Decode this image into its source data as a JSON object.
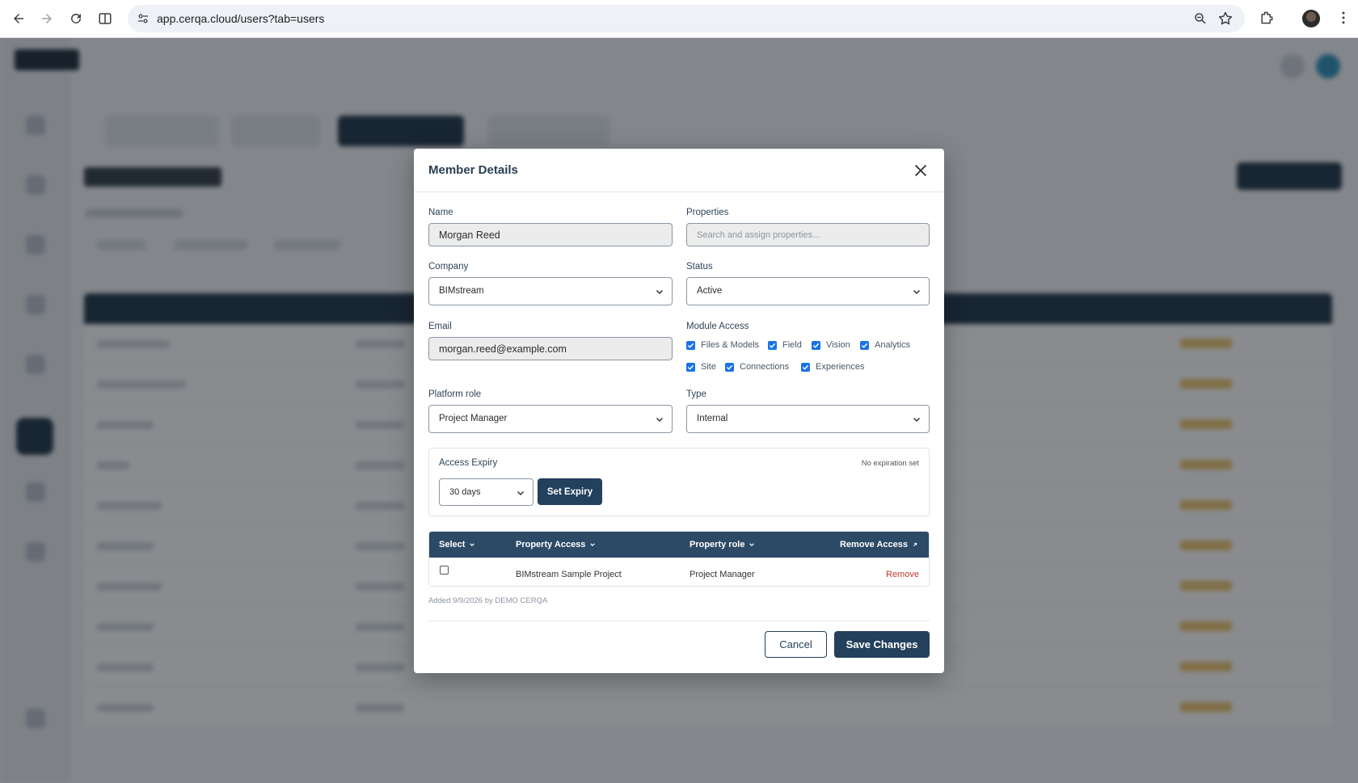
{
  "browser": {
    "url": "app.cerqa.cloud/users?tab=users"
  },
  "modal": {
    "title": "Member Details",
    "name": {
      "label": "Name",
      "value": "Morgan Reed"
    },
    "properties": {
      "label": "Properties",
      "placeholder": "Search and assign properties..."
    },
    "company": {
      "label": "Company",
      "value": "BIMstream"
    },
    "status": {
      "label": "Status",
      "value": "Active"
    },
    "email": {
      "label": "Email",
      "value": "morgan.reed@example.com"
    },
    "module_access": {
      "label": "Module Access",
      "modules": [
        {
          "label": "Files & Models",
          "checked": true
        },
        {
          "label": "Field",
          "checked": true
        },
        {
          "label": "Vision",
          "checked": true
        },
        {
          "label": "Analytics",
          "checked": true
        },
        {
          "label": "Site",
          "checked": true
        },
        {
          "label": "Connections",
          "checked": true
        },
        {
          "label": "Experiences",
          "checked": true
        }
      ]
    },
    "platform_role": {
      "label": "Platform role",
      "value": "Project Manager"
    },
    "type": {
      "label": "Type",
      "value": "Internal"
    },
    "access_expiry": {
      "label": "Access Expiry",
      "status": "No expiration set",
      "duration": "30 days",
      "set_button": "Set Expiry"
    },
    "table": {
      "headers": [
        "Select",
        "Property Access",
        "Property role",
        "Remove Access"
      ],
      "rows": [
        {
          "selected": false,
          "property": "BIMstream Sample Project",
          "role": "Project Manager",
          "action": "Remove"
        }
      ]
    },
    "added_note": "Added 9/9/2026 by DEMO CERQA",
    "cancel_label": "Cancel",
    "save_label": "Save Changes"
  },
  "colors": {
    "primary": "#23405c",
    "table_header": "#2c4a66",
    "danger": "#c0392b",
    "checkbox": "#1a73e8"
  }
}
